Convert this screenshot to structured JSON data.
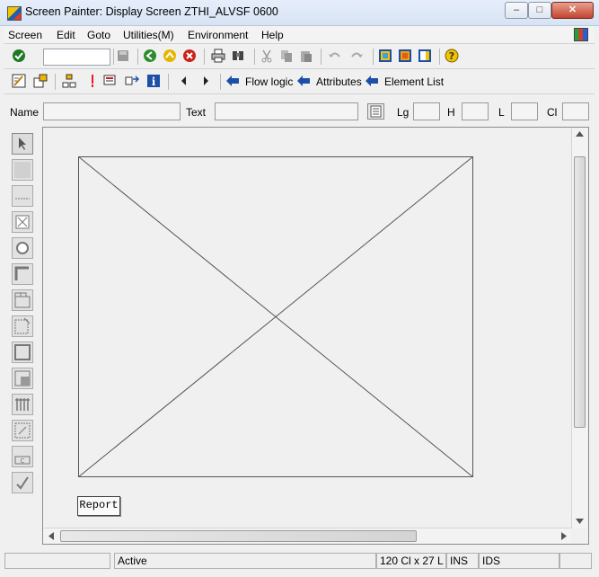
{
  "window": {
    "title": "Screen Painter:  Display Screen ZTHI_ALVSF 0600",
    "minimize": "0",
    "maximize": "1",
    "close": "r"
  },
  "menubar": {
    "items": [
      "Screen",
      "Edit",
      "Goto",
      "Utilities(M)",
      "Environment",
      "Help"
    ]
  },
  "toolbar1": {
    "icons": [
      "enter-icon",
      "command-field",
      "save-icon",
      "back-icon",
      "exit-icon",
      "cancel-icon",
      "print-icon",
      "find-icon",
      "cut-icon",
      "copy-icon",
      "paste-icon",
      "undo-icon",
      "redo-icon",
      "layout-icon",
      "window-icon",
      "fullscreen-icon",
      "help-icon"
    ]
  },
  "toolbar2": {
    "flow_logic": "Flow logic",
    "attributes": "Attributes",
    "element_list": "Element List"
  },
  "fields": {
    "name_label": "Name",
    "text_label": "Text",
    "lg_label": "Lg",
    "h_label": "H",
    "l_label": "L",
    "cl_label": "Cl"
  },
  "canvas": {
    "report_button": "Report"
  },
  "statusbar": {
    "status": "Active",
    "dims": "120 Cl x 27 L",
    "mode": "INS",
    "server": "IDS"
  },
  "colors": {
    "accent_green": "#2a8a2e",
    "title_blue": "#d7e3f4"
  }
}
